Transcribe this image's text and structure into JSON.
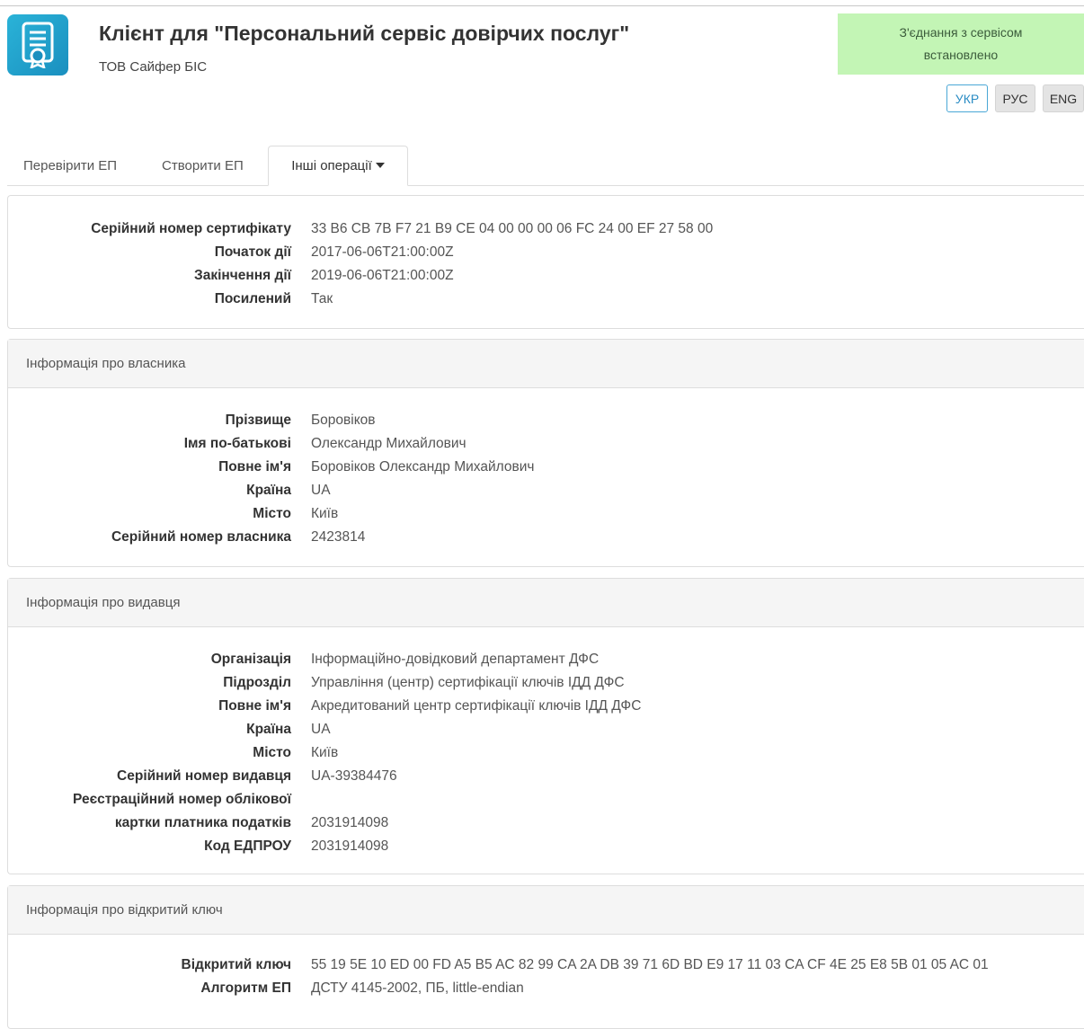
{
  "header": {
    "title": "Клієнт для \"Персональний сервіс довірчих послуг\"",
    "company": "ТОВ Сайфер БІС",
    "logo_icon": "certificate-icon",
    "connection_status": "З'єднання з сервісом встановлено",
    "connection_color": "#c3f5b5"
  },
  "languages": {
    "ukr": "УКР",
    "rus": "РУС",
    "eng": "ENG",
    "active": "УКР"
  },
  "tabs": {
    "verify": "Перевірити ЕП",
    "create": "Створити ЕП",
    "other": "Інші операції",
    "active": "Інші операції"
  },
  "certificate": {
    "rows": [
      {
        "label": "Серійний номер сертифікату",
        "value": "33 B6 CB 7B F7 21 B9 CE 04 00 00 00 06 FC 24 00 EF 27 58 00"
      },
      {
        "label": "Початок дії",
        "value": "2017-06-06T21:00:00Z"
      },
      {
        "label": "Закінчення дії",
        "value": "2019-06-06T21:00:00Z"
      },
      {
        "label": "Посилений",
        "value": "Так"
      }
    ]
  },
  "owner": {
    "heading": "Інформація про власника",
    "rows": [
      {
        "label": "Прізвище",
        "value": "Боровіков"
      },
      {
        "label": "Імя по-батькові",
        "value": "Олександр Михайлович"
      },
      {
        "label": "Повне ім'я",
        "value": "Боровіков Олександр Михайлович"
      },
      {
        "label": "Країна",
        "value": "UA"
      },
      {
        "label": "Місто",
        "value": "Київ"
      },
      {
        "label": "Серійний номер власника",
        "value": "2423814"
      }
    ]
  },
  "issuer": {
    "heading": "Інформація про видавця",
    "rows": [
      {
        "label": "Організація",
        "value": "Інформаційно-довідковий департамент ДФС"
      },
      {
        "label": "Підрозділ",
        "value": "Управління (центр) сертифікації ключів ІДД ДФС"
      },
      {
        "label": "Повне ім'я",
        "value": "Акредитований центр сертифікації ключів ІДД ДФС"
      },
      {
        "label": "Країна",
        "value": "UA"
      },
      {
        "label": "Місто",
        "value": "Київ"
      },
      {
        "label": "Серійний номер видавця",
        "value": "UA-39384476"
      },
      {
        "label": "Реєстраційний номер облікової",
        "value": ""
      },
      {
        "label": "картки платника податків",
        "value": "2031914098"
      },
      {
        "label": "Код ЕДПРОУ",
        "value": "2031914098"
      }
    ]
  },
  "public_key": {
    "heading": "Інформація про відкритий ключ",
    "rows": [
      {
        "label": "Відкритий ключ",
        "value": "55 19 5E 10 ED 00 FD A5 B5 AC 82 99 CA 2A DB 39 71 6D BD E9 17 11 03 CA CF 4E 25 E8 5B 01 05 AC 01"
      },
      {
        "label": "Алгоритм ЕП",
        "value": "ДСТУ 4145-2002, ПБ, little-endian"
      }
    ]
  }
}
